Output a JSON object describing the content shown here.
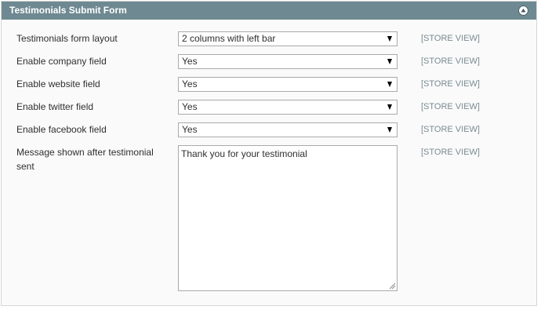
{
  "section": {
    "title": "Testimonials Submit Form",
    "toggle_icon": "collapse-up-icon"
  },
  "fields": [
    {
      "label": "Testimonials form layout",
      "value": "2 columns with left bar",
      "scope": "[STORE VIEW]"
    },
    {
      "label": "Enable company field",
      "value": "Yes",
      "scope": "[STORE VIEW]"
    },
    {
      "label": "Enable website field",
      "value": "Yes",
      "scope": "[STORE VIEW]"
    },
    {
      "label": "Enable twitter field",
      "value": "Yes",
      "scope": "[STORE VIEW]"
    },
    {
      "label": "Enable facebook field",
      "value": "Yes",
      "scope": "[STORE VIEW]"
    }
  ],
  "message_field": {
    "label": "Message shown after testimonial sent",
    "value": "Thank you for your testimonial",
    "scope": "[STORE VIEW]"
  },
  "colors": {
    "header_bg": "#6f8992",
    "scope_text": "#7a8b91"
  }
}
